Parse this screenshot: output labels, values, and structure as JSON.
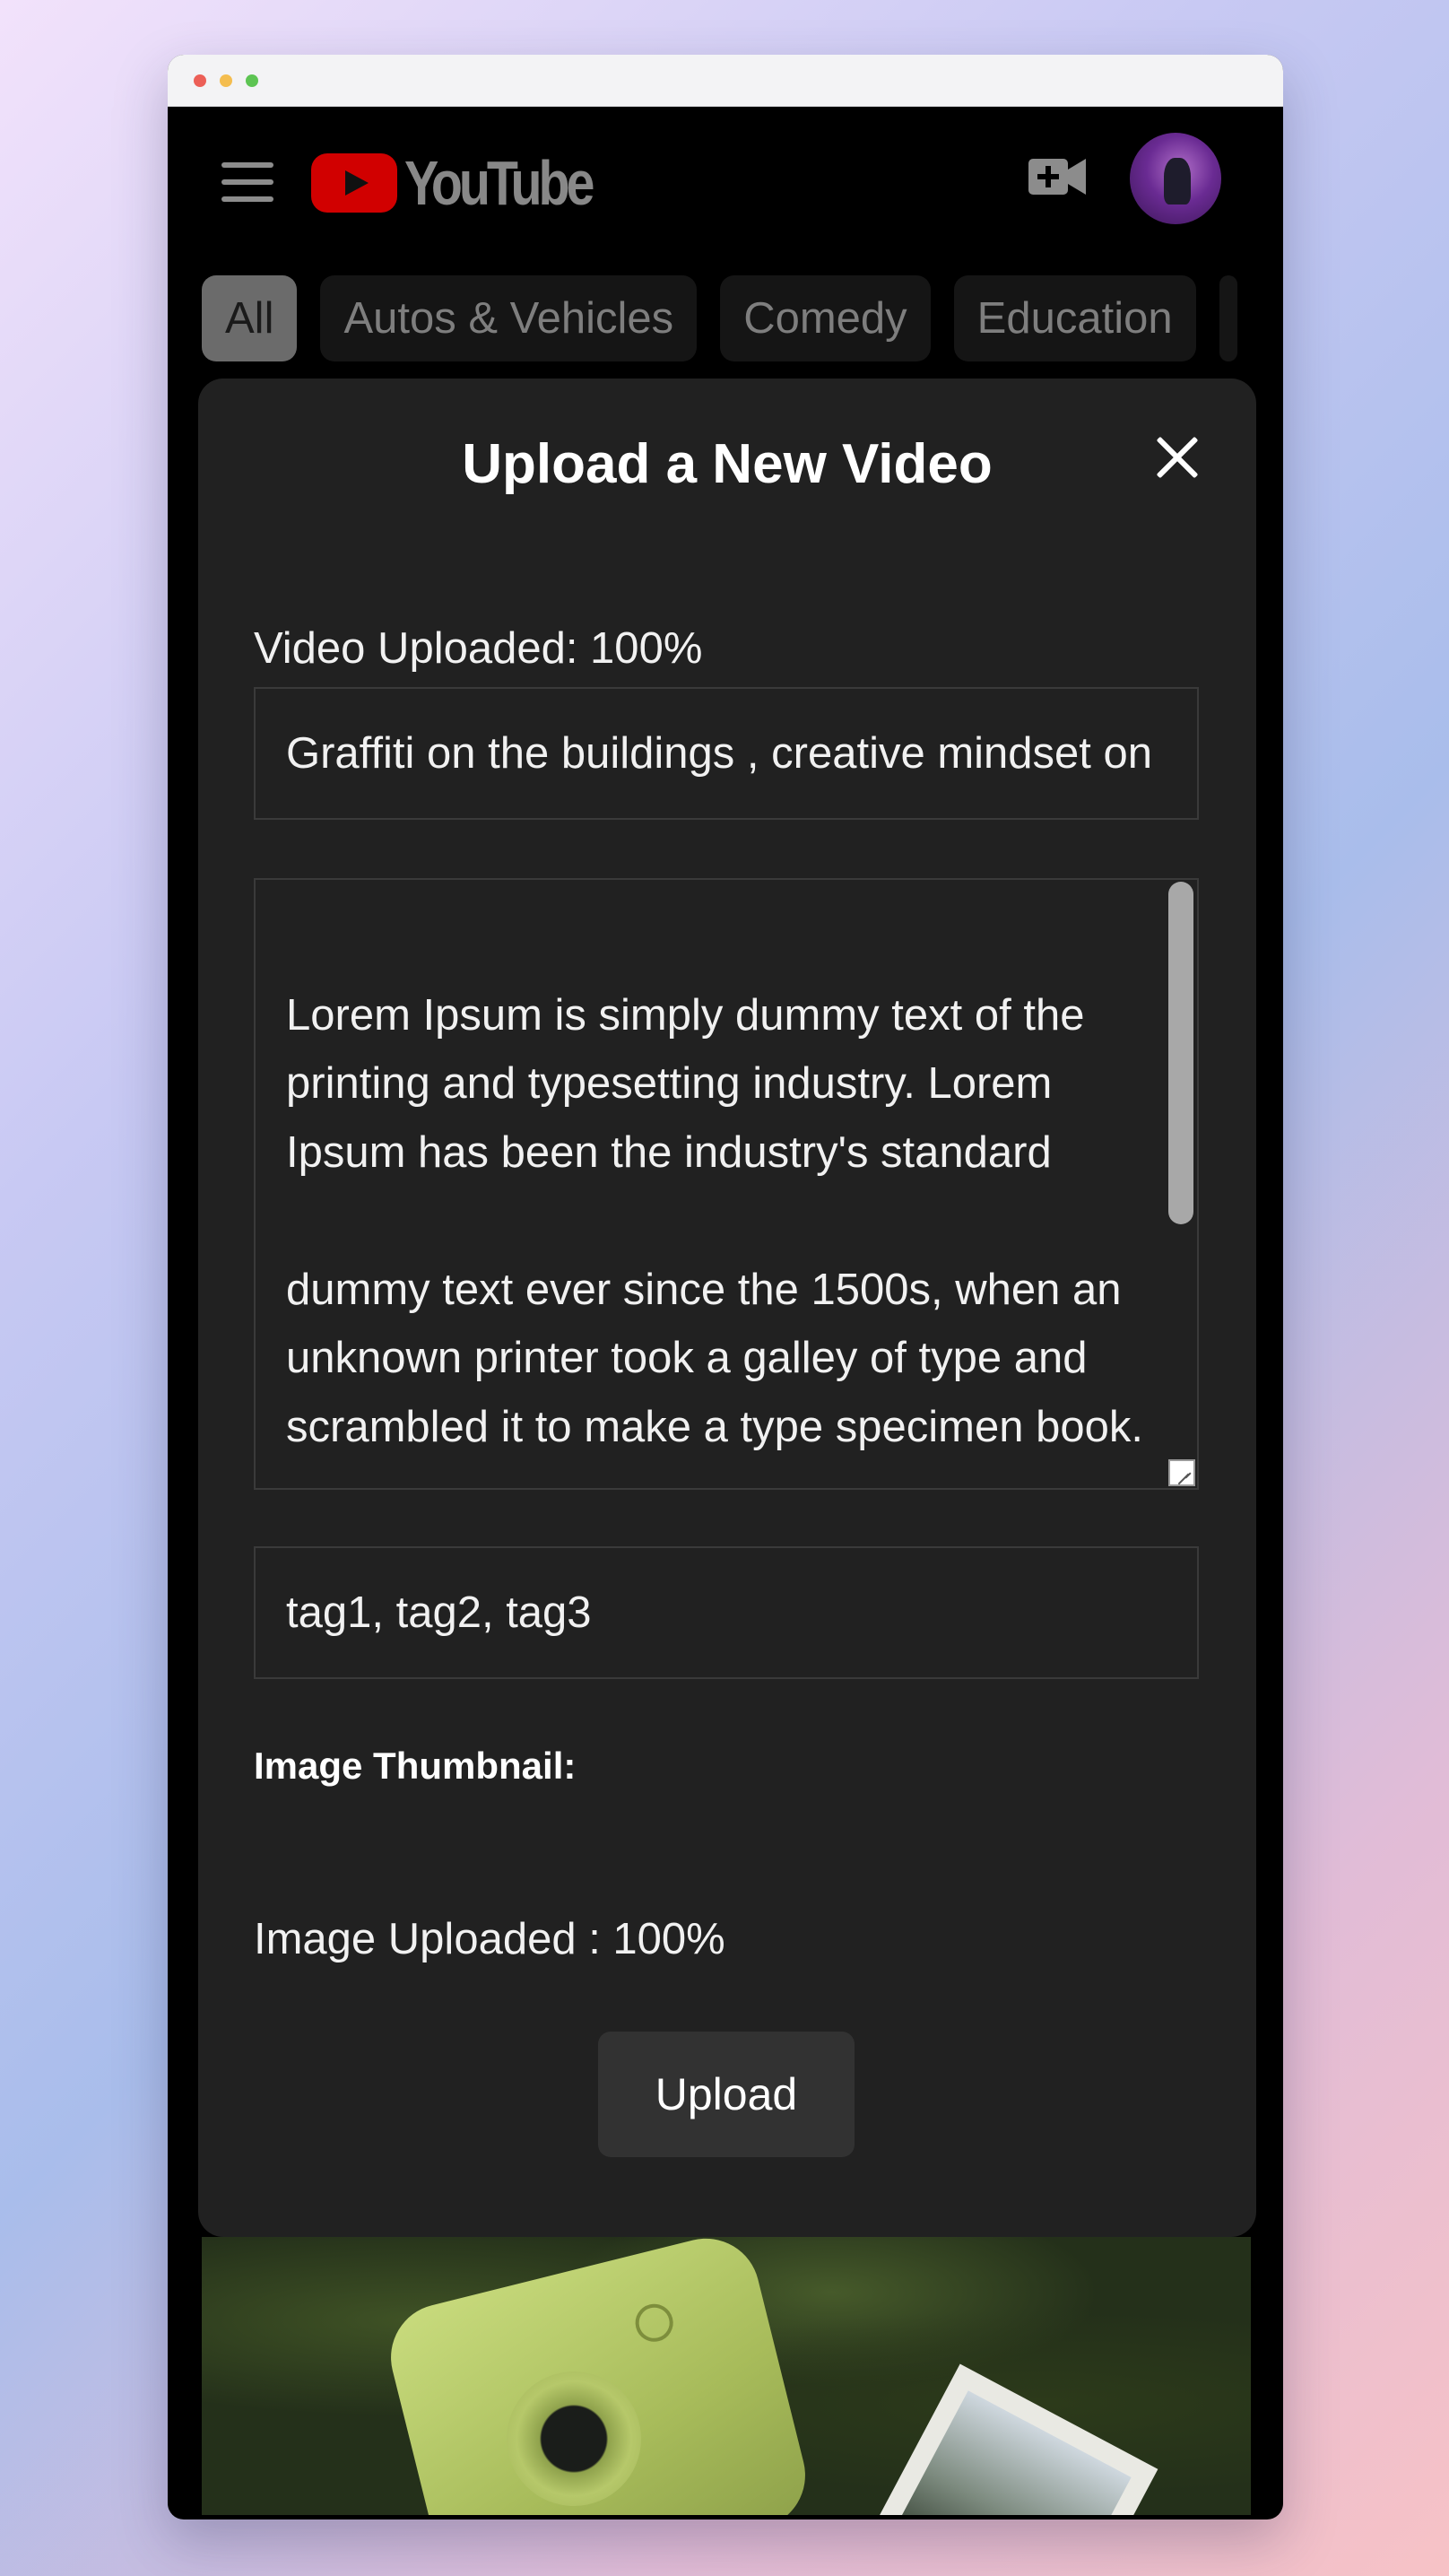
{
  "header": {
    "brand": "YouTube",
    "icons": {
      "menu": "hamburger-icon",
      "create": "video-camera-plus-icon",
      "avatar": "user-avatar"
    },
    "brand_color": "#d10000"
  },
  "chips": [
    "All",
    "Autos & Vehicles",
    "Comedy",
    "Education"
  ],
  "modal": {
    "title": "Upload a New Video",
    "video_status": "Video Uploaded: 100%",
    "title_value": "Graffiti on the buildings , creative mindset on",
    "description": "Lorem Ipsum is simply dummy text of the printing and typesetting industry. Lorem Ipsum has been the industry's standard\n\ndummy text ever since the 1500s, when an unknown printer took a galley of type and scrambled it to make a type specimen book.",
    "tags_value": "tag1, tag2, tag3",
    "thumbnail_label": "Image Thumbnail:",
    "image_status": "Image Uploaded : 100%",
    "upload_label": "Upload",
    "close_icon": "close-icon"
  },
  "thumbnail_image": "instax-camera-photo"
}
